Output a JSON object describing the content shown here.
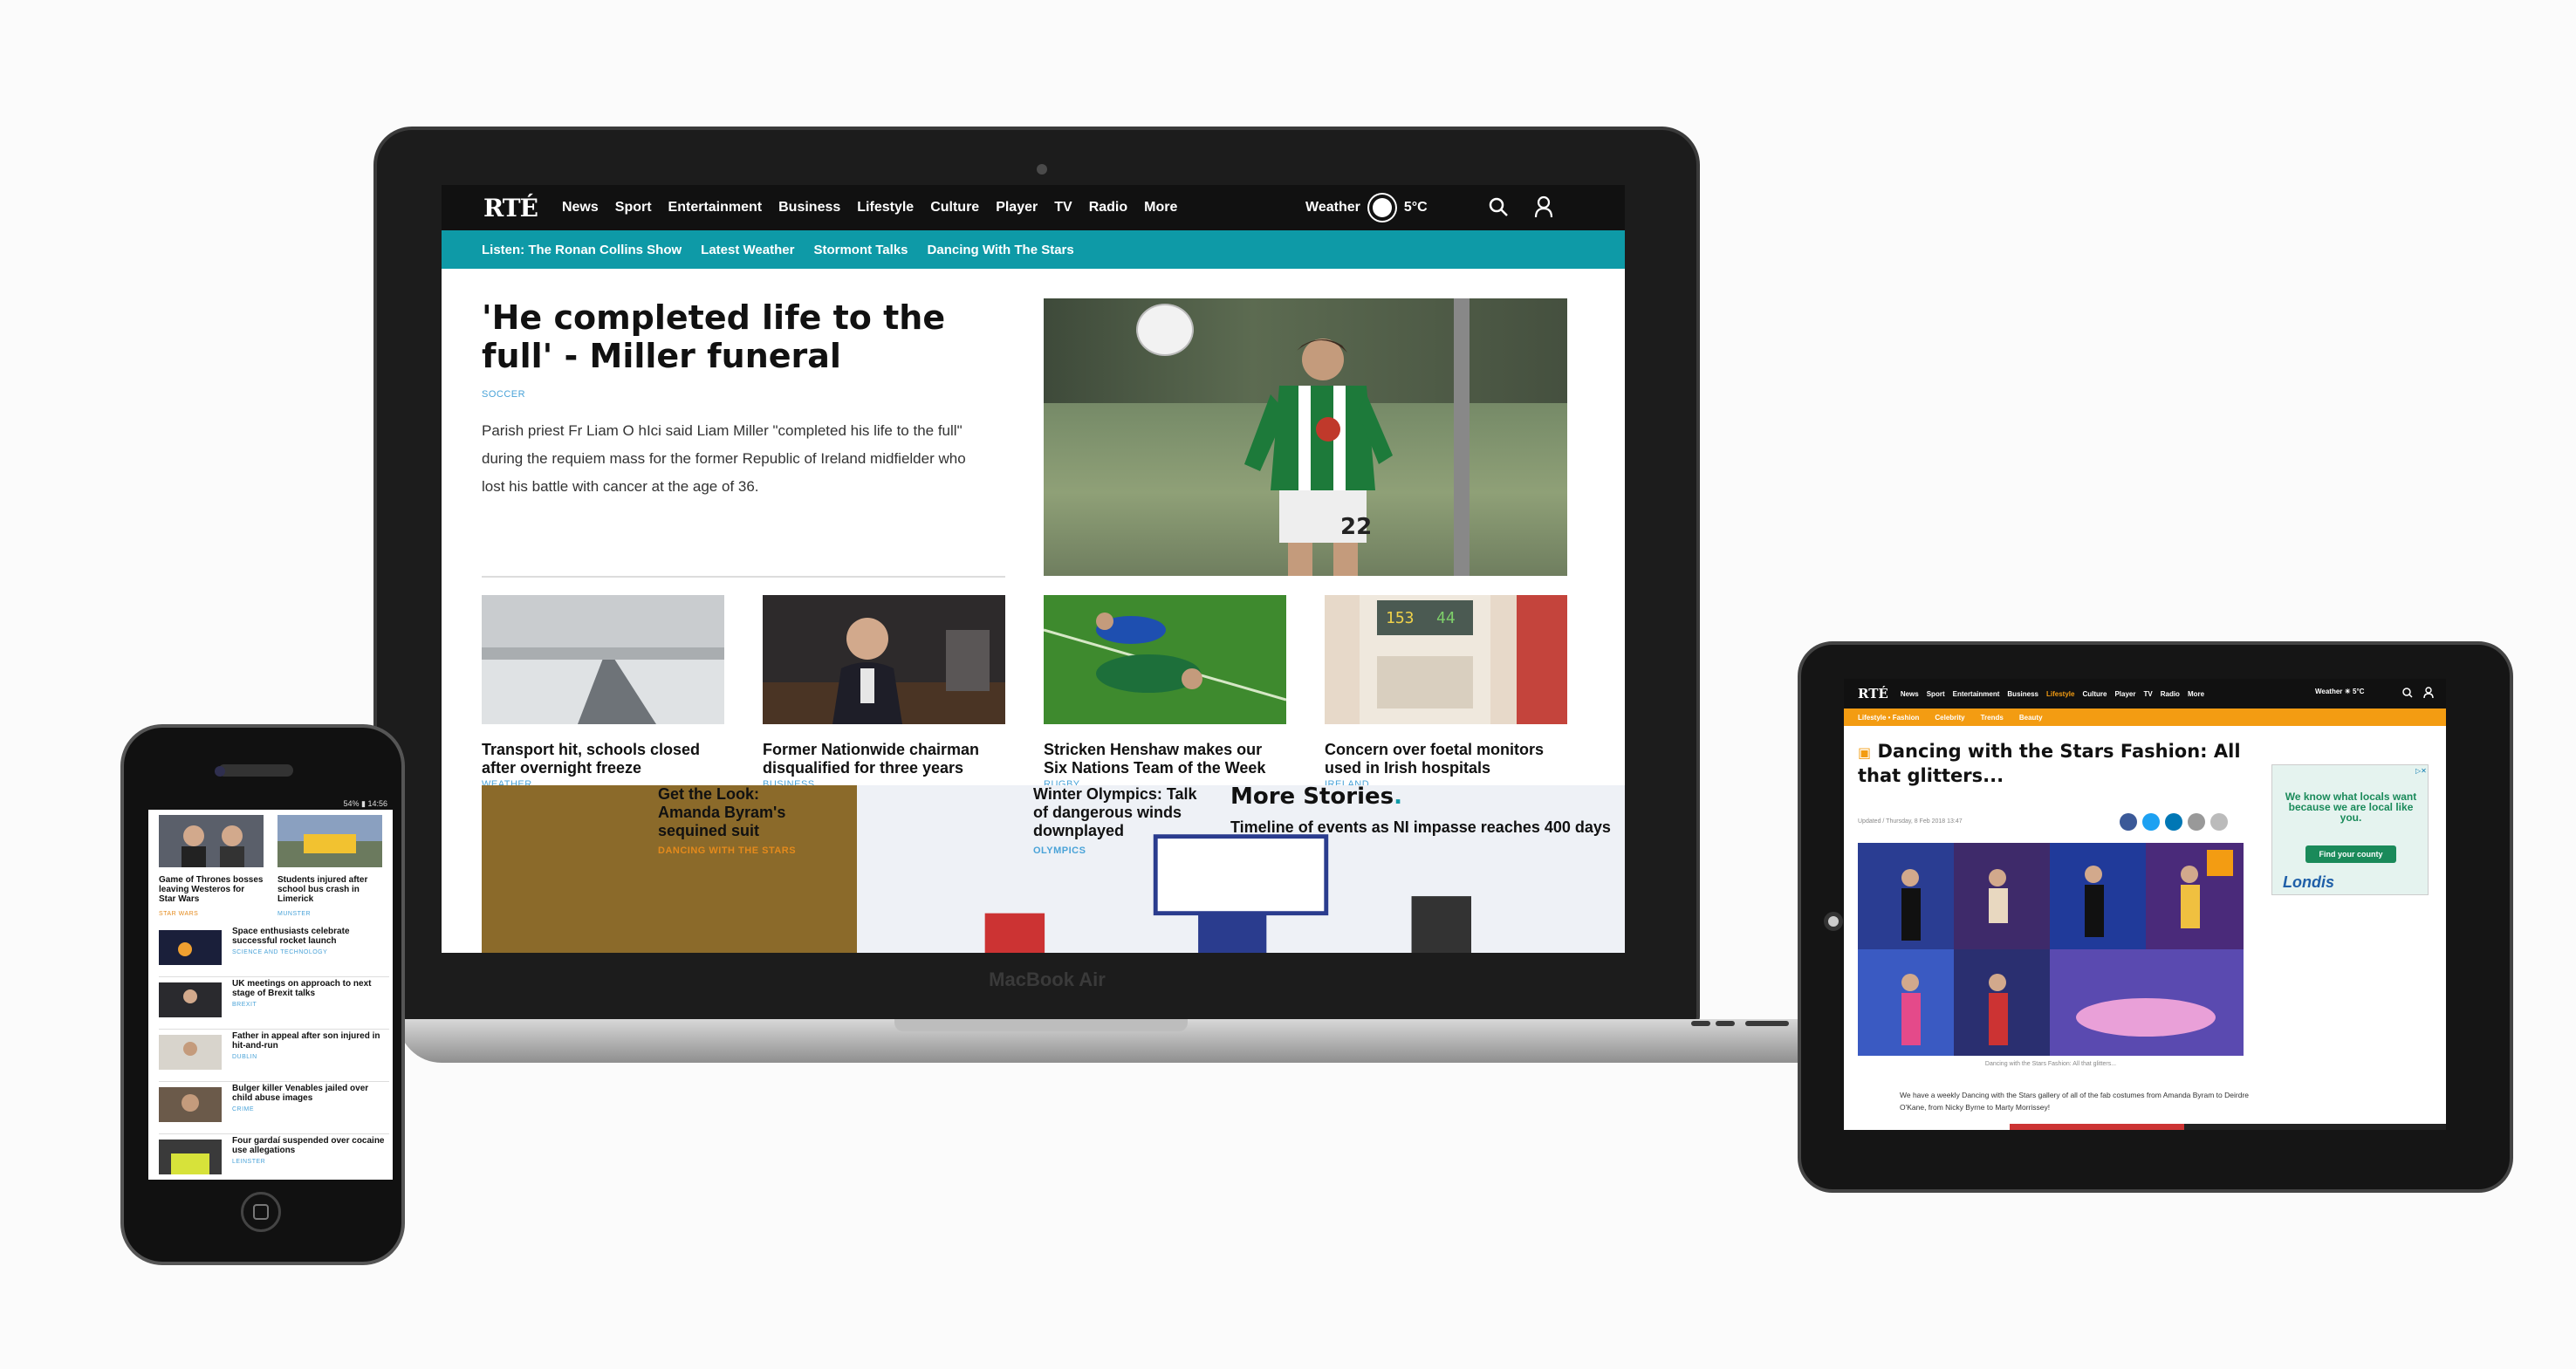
{
  "laptop": {
    "brand": "MacBook Air",
    "logo": "RTÉ",
    "nav": [
      "News",
      "Sport",
      "Entertainment",
      "Business",
      "Lifestyle",
      "Culture",
      "Player",
      "TV",
      "Radio",
      "More"
    ],
    "weather_label": "Weather",
    "weather_temp": "5°C",
    "weather_icon": "sun-icon",
    "subnav": [
      "Listen: The Ronan Collins Show",
      "Latest Weather",
      "Stormont Talks",
      "Dancing With The Stars"
    ],
    "lead": {
      "headline": "'He completed life to the full' - Miller funeral",
      "tag": "SOCCER",
      "summary": "Parish priest Fr Liam O hIci said Liam Miller \"completed his life to the full\" during the requiem mass for the former Republic of Ireland midfielder who lost his battle with cancer at the age of 36."
    },
    "cards": [
      {
        "title": "Transport hit, schools closed after overnight freeze",
        "tag": "WEATHER"
      },
      {
        "title": "Former Nationwide chairman disqualified for three years",
        "tag": "BUSINESS"
      },
      {
        "title": "Stricken Henshaw makes our Six Nations Team of the Week",
        "tag": "RUGBY"
      },
      {
        "title": "Concern over foetal monitors used in Irish hospitals",
        "tag": "IRELAND"
      }
    ],
    "bottom": [
      {
        "title": "Get the Look: Amanda Byram's sequined suit",
        "tag": "DANCING WITH THE STARS"
      },
      {
        "title": "Winter Olympics: Talk of dangerous winds downplayed",
        "tag": "OLYMPICS"
      }
    ],
    "more_stories": {
      "title": "More Stories",
      "dot": ".",
      "item": "Timeline of events as NI impasse reaches 400 days"
    }
  },
  "phone": {
    "status": "54% ▮ 14:56",
    "top": [
      {
        "title": "Game of Thrones bosses leaving Westeros for Star Wars",
        "tag": "STAR WARS"
      },
      {
        "title": "Students injured after school bus crash in Limerick",
        "tag": "MUNSTER"
      }
    ],
    "rows": [
      {
        "title": "Space enthusiasts celebrate successful rocket launch",
        "tag": "SCIENCE AND TECHNOLOGY"
      },
      {
        "title": "UK meetings on approach to next stage of Brexit talks",
        "tag": "BREXIT"
      },
      {
        "title": "Father in appeal after son injured in hit-and-run",
        "tag": "DUBLIN"
      },
      {
        "title": "Bulger killer Venables jailed over child abuse images",
        "tag": "CRIME"
      },
      {
        "title": "Four gardaí suspended over cocaine use allegations",
        "tag": "LEINSTER"
      }
    ]
  },
  "tablet": {
    "logo": "RTÉ",
    "nav": [
      "News",
      "Sport",
      "Entertainment",
      "Business",
      "Lifestyle",
      "Culture",
      "Player",
      "TV",
      "Radio",
      "More"
    ],
    "weather": "Weather ☀ 5°C",
    "subnav": [
      "Lifestyle • Fashion",
      "Celebrity",
      "Trends",
      "Beauty"
    ],
    "title": "Dancing with the Stars Fashion: All that glitters...",
    "updated": "Updated / Thursday, 8 Feb 2018 13:47",
    "caption": "Dancing with the Stars Fashion: All that glitters...",
    "body": "We have a weekly Dancing with the Stars gallery of all of the fab costumes from Amanda Byram to Deirdre O'Kane, from Nicky Byrne to Marty Morrissey!",
    "ad": {
      "text": "We know what locals want because we are local like you.",
      "button": "Find your county",
      "logo": "Londis"
    }
  },
  "colors": {
    "accent_teal": "#0e9aa7",
    "tablet_orange": "#f39c12",
    "nav_black": "#111111"
  }
}
